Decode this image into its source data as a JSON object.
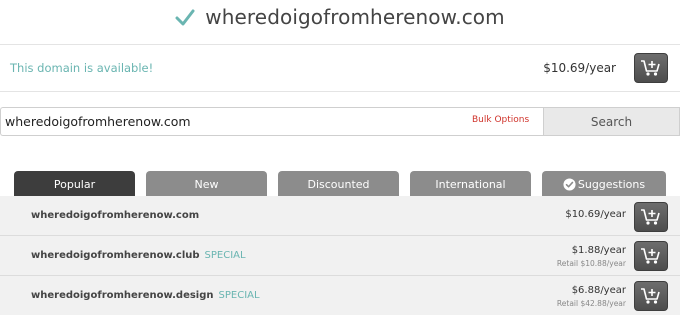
{
  "header": {
    "domain": "wheredoigofromherenow.com"
  },
  "availability": {
    "message": "This domain is available!",
    "price": "$10.69/year"
  },
  "search": {
    "value": "wheredoigofromherenow.com",
    "bulk_label": "Bulk Options",
    "button_label": "Search"
  },
  "tabs": [
    {
      "label": "Popular",
      "active": true
    },
    {
      "label": "New",
      "active": false
    },
    {
      "label": "Discounted",
      "active": false
    },
    {
      "label": "International",
      "active": false
    },
    {
      "label": "Suggestions",
      "active": false
    }
  ],
  "results": [
    {
      "name": "wheredoigofromherenow.com",
      "badge": "",
      "price": "$10.69/year",
      "retail": ""
    },
    {
      "name": "wheredoigofromherenow.club",
      "badge": "SPECIAL",
      "price": "$1.88/year",
      "retail": "Retail $10.88/year"
    },
    {
      "name": "wheredoigofromherenow.design",
      "badge": "SPECIAL",
      "price": "$6.88/year",
      "retail": "Retail $42.88/year"
    }
  ],
  "colors": {
    "accent": "#6ab5b1",
    "link_red": "#d0342c",
    "tab_active": "#3d3d3d",
    "tab_inactive": "#8c8c8c"
  }
}
